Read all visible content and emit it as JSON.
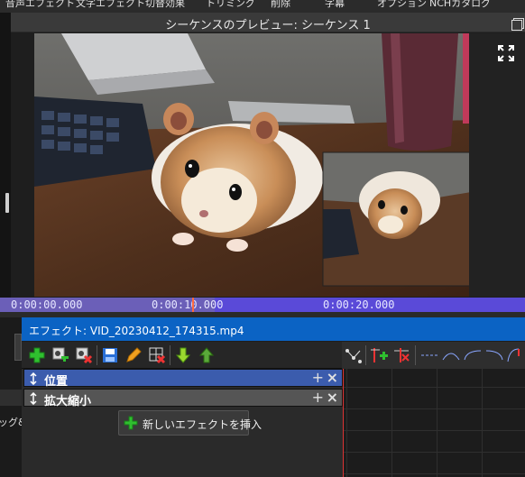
{
  "menu": [
    "音声エフェクト",
    "文字エフェクト",
    "切替効果",
    "トリミング",
    "削除",
    "字幕",
    "オプション",
    "NCHカタログ"
  ],
  "preview": {
    "title": "シーケンスのプレビュー: シーケンス 1"
  },
  "timeline": {
    "ticks": [
      "0:00:00.000",
      "0:00:10.000",
      "0:00:20.000"
    ]
  },
  "effects_panel": {
    "title": "エフェクト: VID_20230412_174315.mp4",
    "rows": [
      "位置",
      "拡大縮小"
    ],
    "insert_button": "新しいエフェクトを挿入"
  },
  "left_panel": {
    "cut_text": "ッグ&"
  },
  "colors": {
    "accent": "#0b63c4",
    "ruler": "#5a4ad8",
    "playhead": "#ff6a3d",
    "add_green": "#2fbf2f"
  }
}
